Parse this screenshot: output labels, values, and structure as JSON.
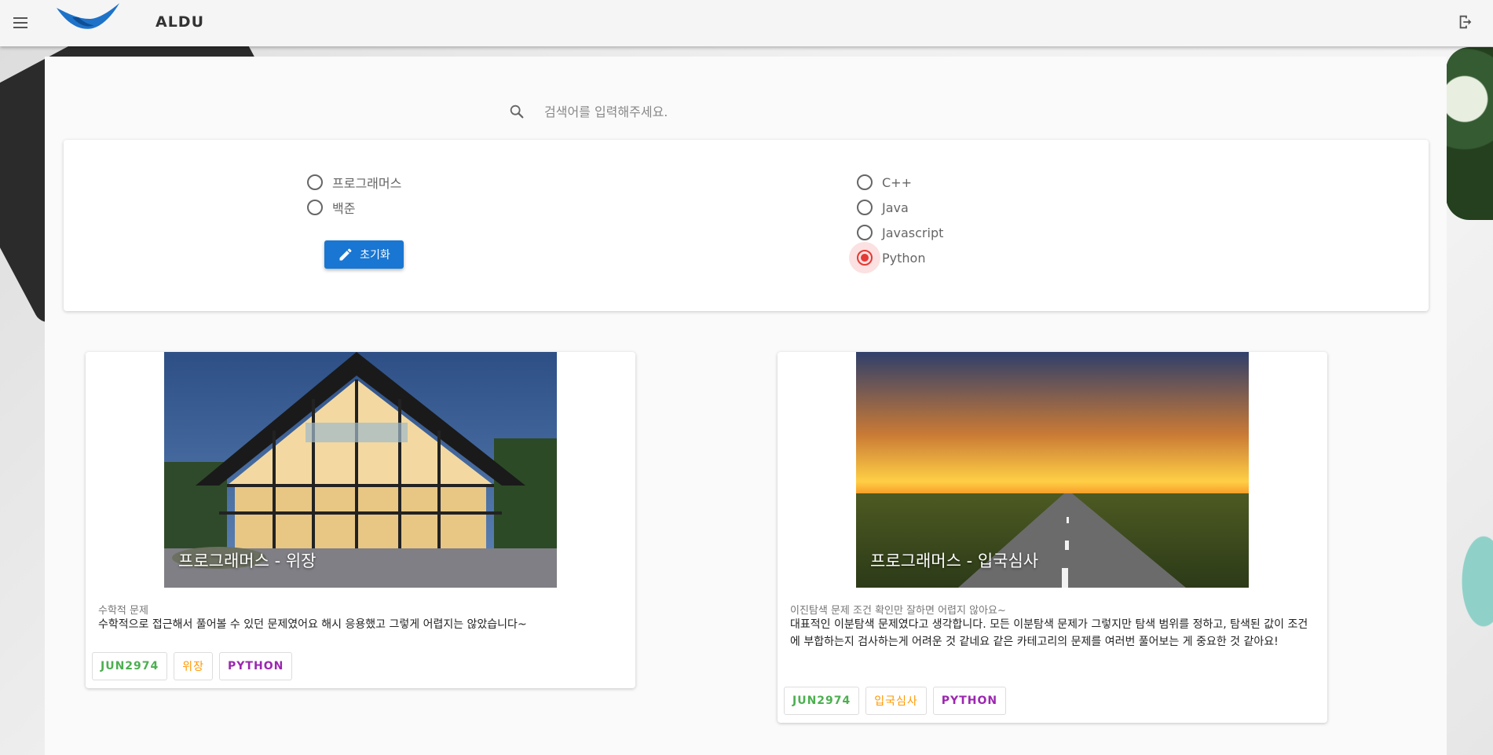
{
  "appbar": {
    "title": "ALDU"
  },
  "search": {
    "placeholder": "검색어를 입력해주세요."
  },
  "filters": {
    "sites": [
      {
        "label": "프로그래머스",
        "checked": false
      },
      {
        "label": "백준",
        "checked": false
      }
    ],
    "languages": [
      {
        "label": "C++",
        "checked": false
      },
      {
        "label": "Java",
        "checked": false
      },
      {
        "label": "Javascript",
        "checked": false
      },
      {
        "label": "Python",
        "checked": true
      }
    ],
    "reset_label": "초기화"
  },
  "colors": {
    "primary": "#1976d2",
    "radio_checked": "#e53935",
    "chip_user": "#4caf50",
    "chip_problem": "#ff9800",
    "chip_lang": "#9c27b0"
  },
  "cards": [
    {
      "image_title": "프로그래머스 - 위장",
      "subtitle": "수학적 문제",
      "text": "수학적으로 접근해서 풀어볼 수 있던 문제였어요 해시 응용했고 그렇게 어렵지는 않았습니다~",
      "chips": [
        "JUN2974",
        "위장",
        "PYTHON"
      ]
    },
    {
      "image_title": "프로그래머스 - 입국심사",
      "subtitle": "이진탐색 문제 조건 확인만 잘하면 어렵지 않아요~",
      "text": "대표적인 이분탐색 문제였다고 생각합니다. 모든 이분탐색 문제가 그렇지만 탐색 범위를 정하고, 탐색된 값이 조건에 부합하는지 검사하는게 어려운 것 같네요 같은 카테고리의 문제를 여러번 풀어보는 게 중요한 것 같아요!",
      "chips": [
        "JUN2974",
        "입국심사",
        "PYTHON"
      ]
    }
  ]
}
